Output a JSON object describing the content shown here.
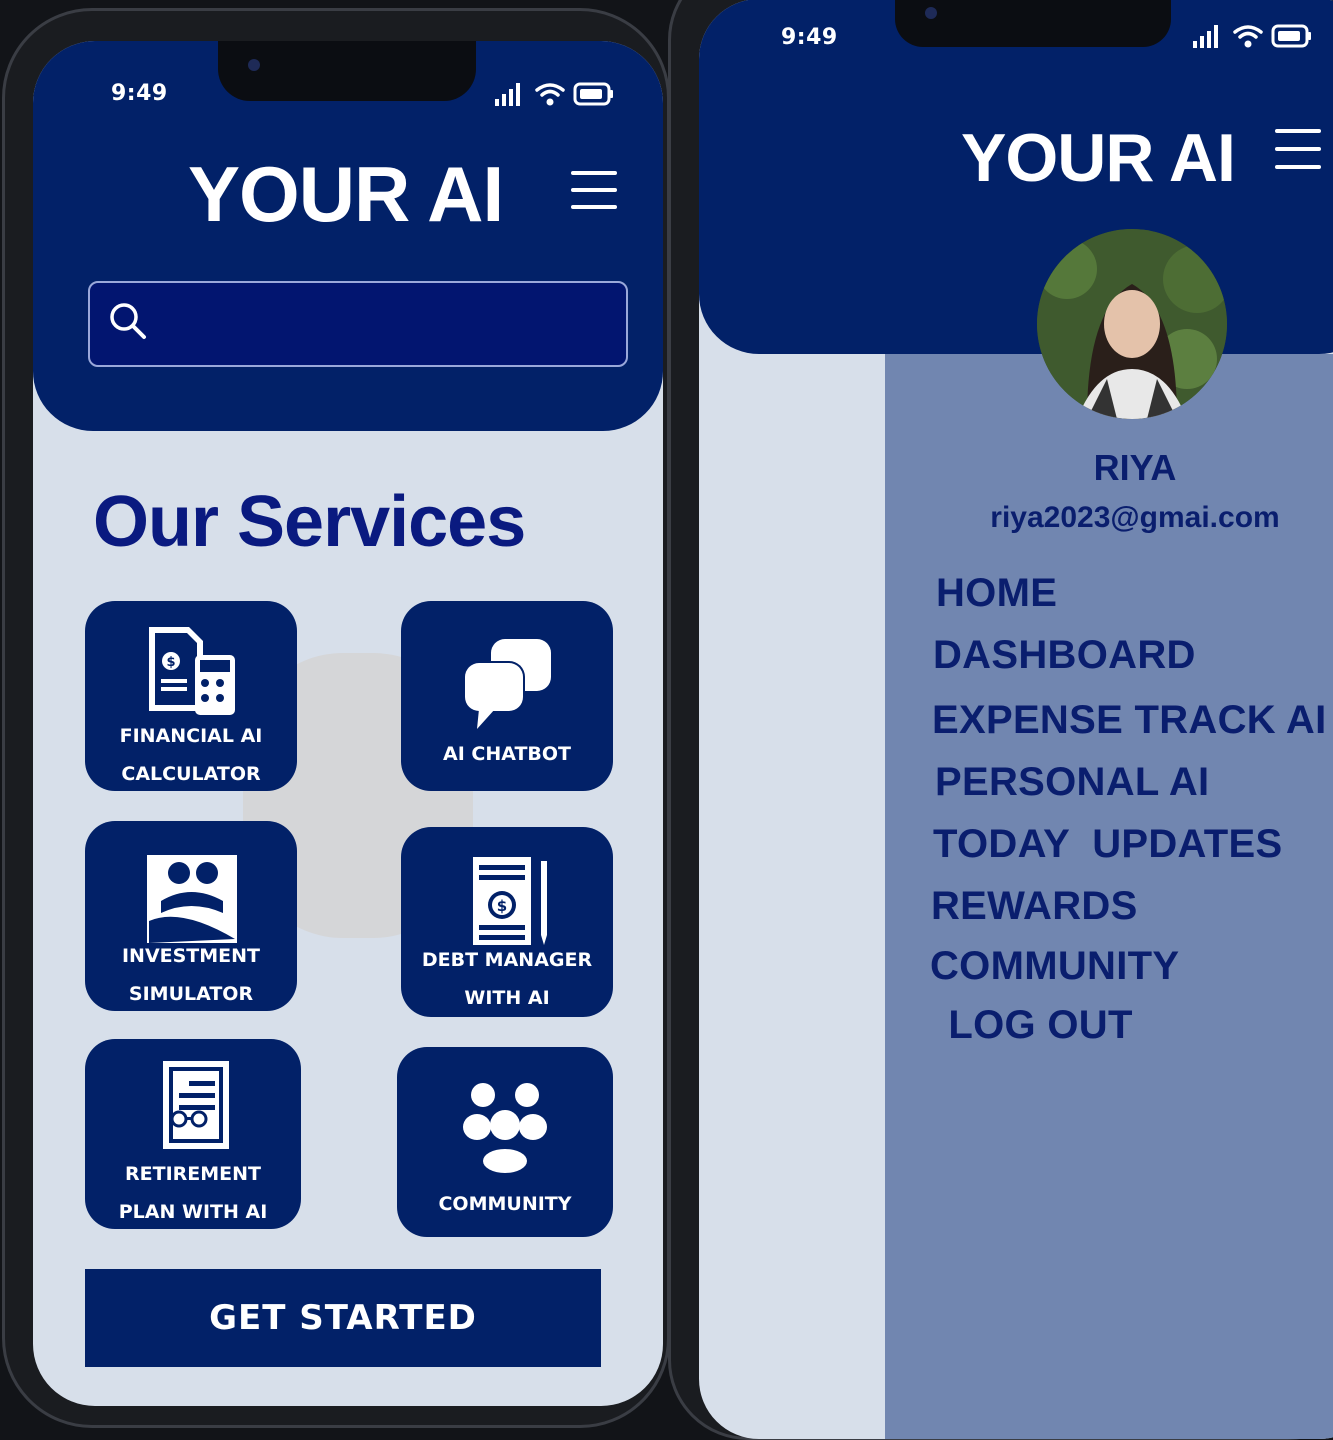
{
  "colors": {
    "primary": "#022168",
    "screen_bg": "#d7dfea",
    "drawer_bg": "#7186b0",
    "heading": "#0a1a80",
    "text_light": "#ffffff"
  },
  "left_screen": {
    "status_bar": {
      "time": "9:49",
      "icons": [
        "signal-icon",
        "wifi-icon",
        "battery-icon"
      ]
    },
    "header": {
      "title": "YOUR AI",
      "menu_icon": "hamburger-icon"
    },
    "search": {
      "icon": "search-icon",
      "value": ""
    },
    "section_title": "Our Services",
    "services": [
      {
        "label": "FINANCIAL AI\nCALCULATOR",
        "icon": "calculator-document-icon"
      },
      {
        "label": "AI CHATBOT",
        "icon": "chat-bubbles-icon"
      },
      {
        "label": "INVESTMENT\nSIMULATOR",
        "icon": "investment-icon"
      },
      {
        "label": "DEBT MANAGER\nWITH AI",
        "icon": "debt-document-icon"
      },
      {
        "label": "RETIREMENT\nPLAN WITH AI",
        "icon": "retirement-plan-icon"
      },
      {
        "label": "COMMUNITY",
        "icon": "community-icon"
      }
    ],
    "cta_label": "GET STARTED"
  },
  "right_screen": {
    "status_bar": {
      "time": "9:49",
      "icons": [
        "signal-icon",
        "wifi-icon",
        "battery-icon"
      ]
    },
    "header": {
      "title": "YOUR AI",
      "menu_icon": "hamburger-icon"
    },
    "profile": {
      "name": "RIYA",
      "email": "riya2023@gmai.com",
      "avatar": "profile-photo"
    },
    "menu": [
      "HOME",
      "DASHBOARD",
      "EXPENSE TRACK AI",
      "PERSONAL AI",
      "TODAY  UPDATES",
      "REWARDS",
      "COMMUNITY",
      " LOG OUT"
    ]
  }
}
